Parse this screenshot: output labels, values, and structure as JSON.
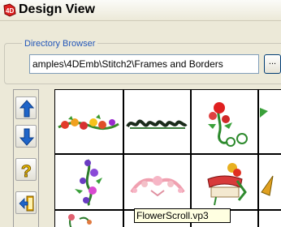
{
  "window": {
    "title": "Design View",
    "icon": "4d-app-icon"
  },
  "directory_browser": {
    "label": "Directory Browser",
    "path": "amples\\4DEmb\\Stitch2\\Frames and Borders",
    "browse_label": "..."
  },
  "tools": [
    {
      "name": "move-up-icon"
    },
    {
      "name": "move-down-icon"
    },
    {
      "name": "help-icon"
    },
    {
      "name": "exit-icon"
    }
  ],
  "designs": [
    {
      "name": "fruit-border-design"
    },
    {
      "name": "text-border-design"
    },
    {
      "name": "flower-vine-design"
    },
    {
      "name": "flower-garland-design"
    },
    {
      "name": "pink-scroll-design"
    },
    {
      "name": "ribbon-banner-design"
    },
    {
      "name": "partial-design-right"
    },
    {
      "name": "tulip-design"
    }
  ],
  "tooltip": {
    "text": "FlowerScroll.vp3"
  },
  "colors": {
    "title_bar": "#ece9d8",
    "legend_text": "#2356b8",
    "tooltip_bg": "#ffffe1",
    "arrow_blue": "#1e64c8"
  }
}
